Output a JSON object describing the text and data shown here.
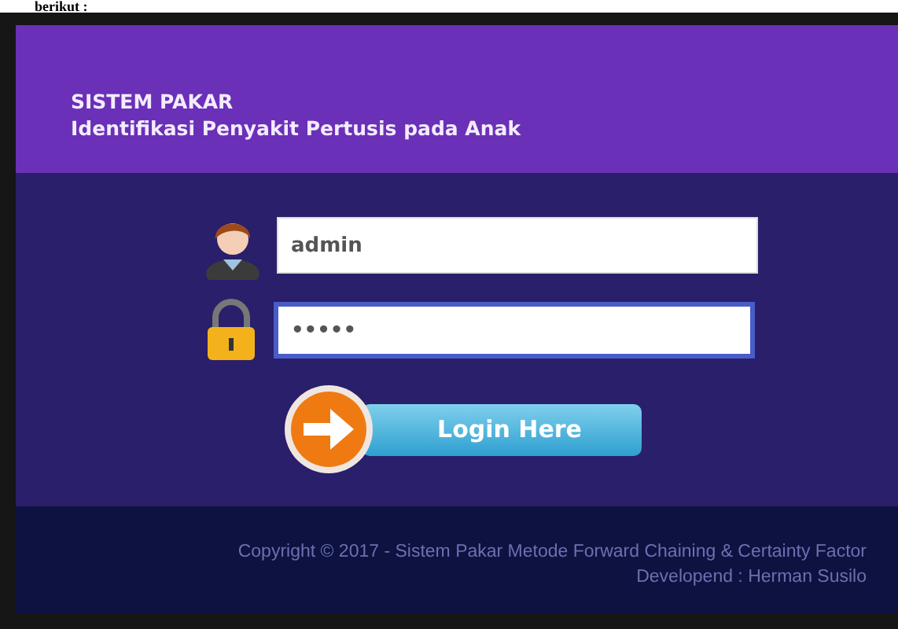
{
  "document_text": "berikut :",
  "header": {
    "title": "SISTEM PAKAR",
    "subtitle": "Identifikasi Penyakit Pertusis pada Anak"
  },
  "login_form": {
    "username": {
      "value": "admin",
      "focused": false
    },
    "password": {
      "value": "•••••",
      "focused": true
    },
    "button": "Login Here"
  },
  "footer": {
    "copyright": "Copyright © 2017 - Sistem Pakar Metode Forward Chaining & Certainty Factor",
    "developer": "Developend : Herman Susilo"
  }
}
